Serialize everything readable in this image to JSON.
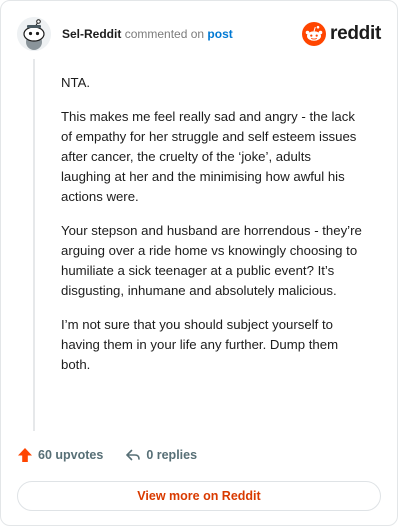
{
  "header": {
    "username": "Sel-Reddit",
    "action": "commented on",
    "post_link": "post",
    "brand": "reddit"
  },
  "comment": {
    "paragraphs": [
      "NTA.",
      "This makes me feel really sad and angry - the lack of empathy for her struggle and self esteem issues after cancer, the cruelty of the ‘joke’, adults laughing at her and the minimising how awful his actions were.",
      "Your stepson and husband are horrendous - they’re arguing over a ride home vs knowingly choosing to humiliate a sick teenager at a public event? It’s disgusting, inhumane and absolutely malicious.",
      "I’m not sure that you should subject yourself to having them in your life any further. Dump them both."
    ]
  },
  "footer": {
    "upvotes": "60 upvotes",
    "replies": "0 replies"
  },
  "view_more": "View more on Reddit",
  "colors": {
    "brand_orange": "#ff4500",
    "link_blue": "#0079d3",
    "cta_orange": "#d93a00"
  }
}
